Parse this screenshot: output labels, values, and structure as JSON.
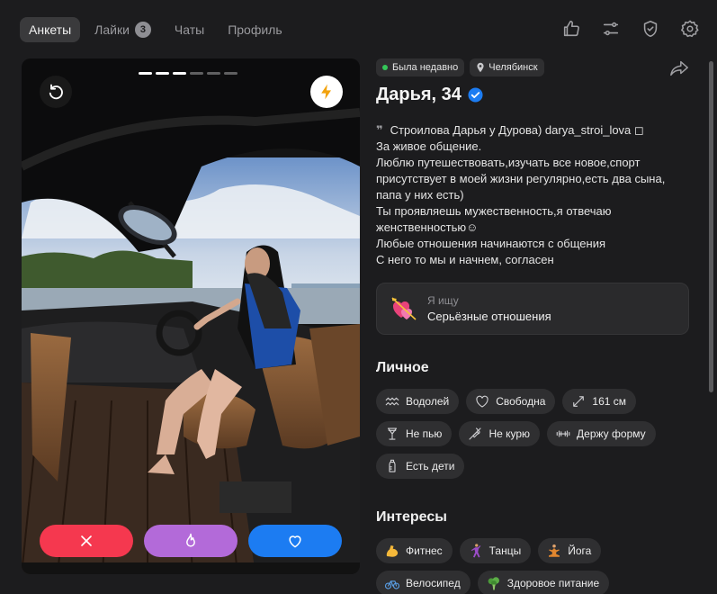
{
  "tabs": [
    {
      "label": "Анкеты",
      "active": true
    },
    {
      "label": "Лайки",
      "badge": "3"
    },
    {
      "label": "Чаты"
    },
    {
      "label": "Профиль"
    }
  ],
  "top_icons": [
    "thumbs-up-icon",
    "sliders-icon",
    "shield-check-icon",
    "gear-icon"
  ],
  "photo": {
    "count": 6,
    "current": 3,
    "buttons": {
      "undo": "undo-icon",
      "boost": "lightning-icon"
    },
    "actions": [
      "close-icon",
      "flame-icon",
      "heart-icon"
    ]
  },
  "profile": {
    "status": "Была недавно",
    "city": "Челябинск",
    "name": "Дарья, 34",
    "verified": true,
    "bio_lines": [
      "Строилова Дарья у Дурова) darya_stroi_lova ◻",
      "За живое общение.",
      "Люблю путешествовать,изучать все новое,спорт присутствует в моей жизни регулярно,есть два сына, папа у них есть)",
      "Ты проявляешь мужественность,я отвечаю женственностью☺",
      "Любые отношения начинаются с общения",
      "С него то мы и начнем, согласен"
    ],
    "looking_for": {
      "label": "Я ищу",
      "value": "Серьёзные отношения"
    }
  },
  "personal": {
    "title": "Личное",
    "tags": [
      {
        "label": "Водолей",
        "icon": "aquarius-icon"
      },
      {
        "label": "Свободна",
        "icon": "heart-outline-icon"
      },
      {
        "label": "161 см",
        "icon": "height-icon"
      },
      {
        "label": "Не пью",
        "icon": "glass-icon"
      },
      {
        "label": "Не курю",
        "icon": "no-smoking-icon"
      },
      {
        "label": "Держу форму",
        "icon": "dumbbell-icon"
      },
      {
        "label": "Есть дети",
        "icon": "baby-bottle-icon"
      }
    ]
  },
  "interests": {
    "title": "Интересы",
    "tags": [
      {
        "label": "Фитнес",
        "icon": "flexed-biceps-icon"
      },
      {
        "label": "Танцы",
        "icon": "dancer-icon"
      },
      {
        "label": "Йога",
        "icon": "yoga-icon"
      },
      {
        "label": "Велосипед",
        "icon": "bicycle-icon"
      },
      {
        "label": "Здоровое питание",
        "icon": "broccoli-icon"
      }
    ]
  }
}
